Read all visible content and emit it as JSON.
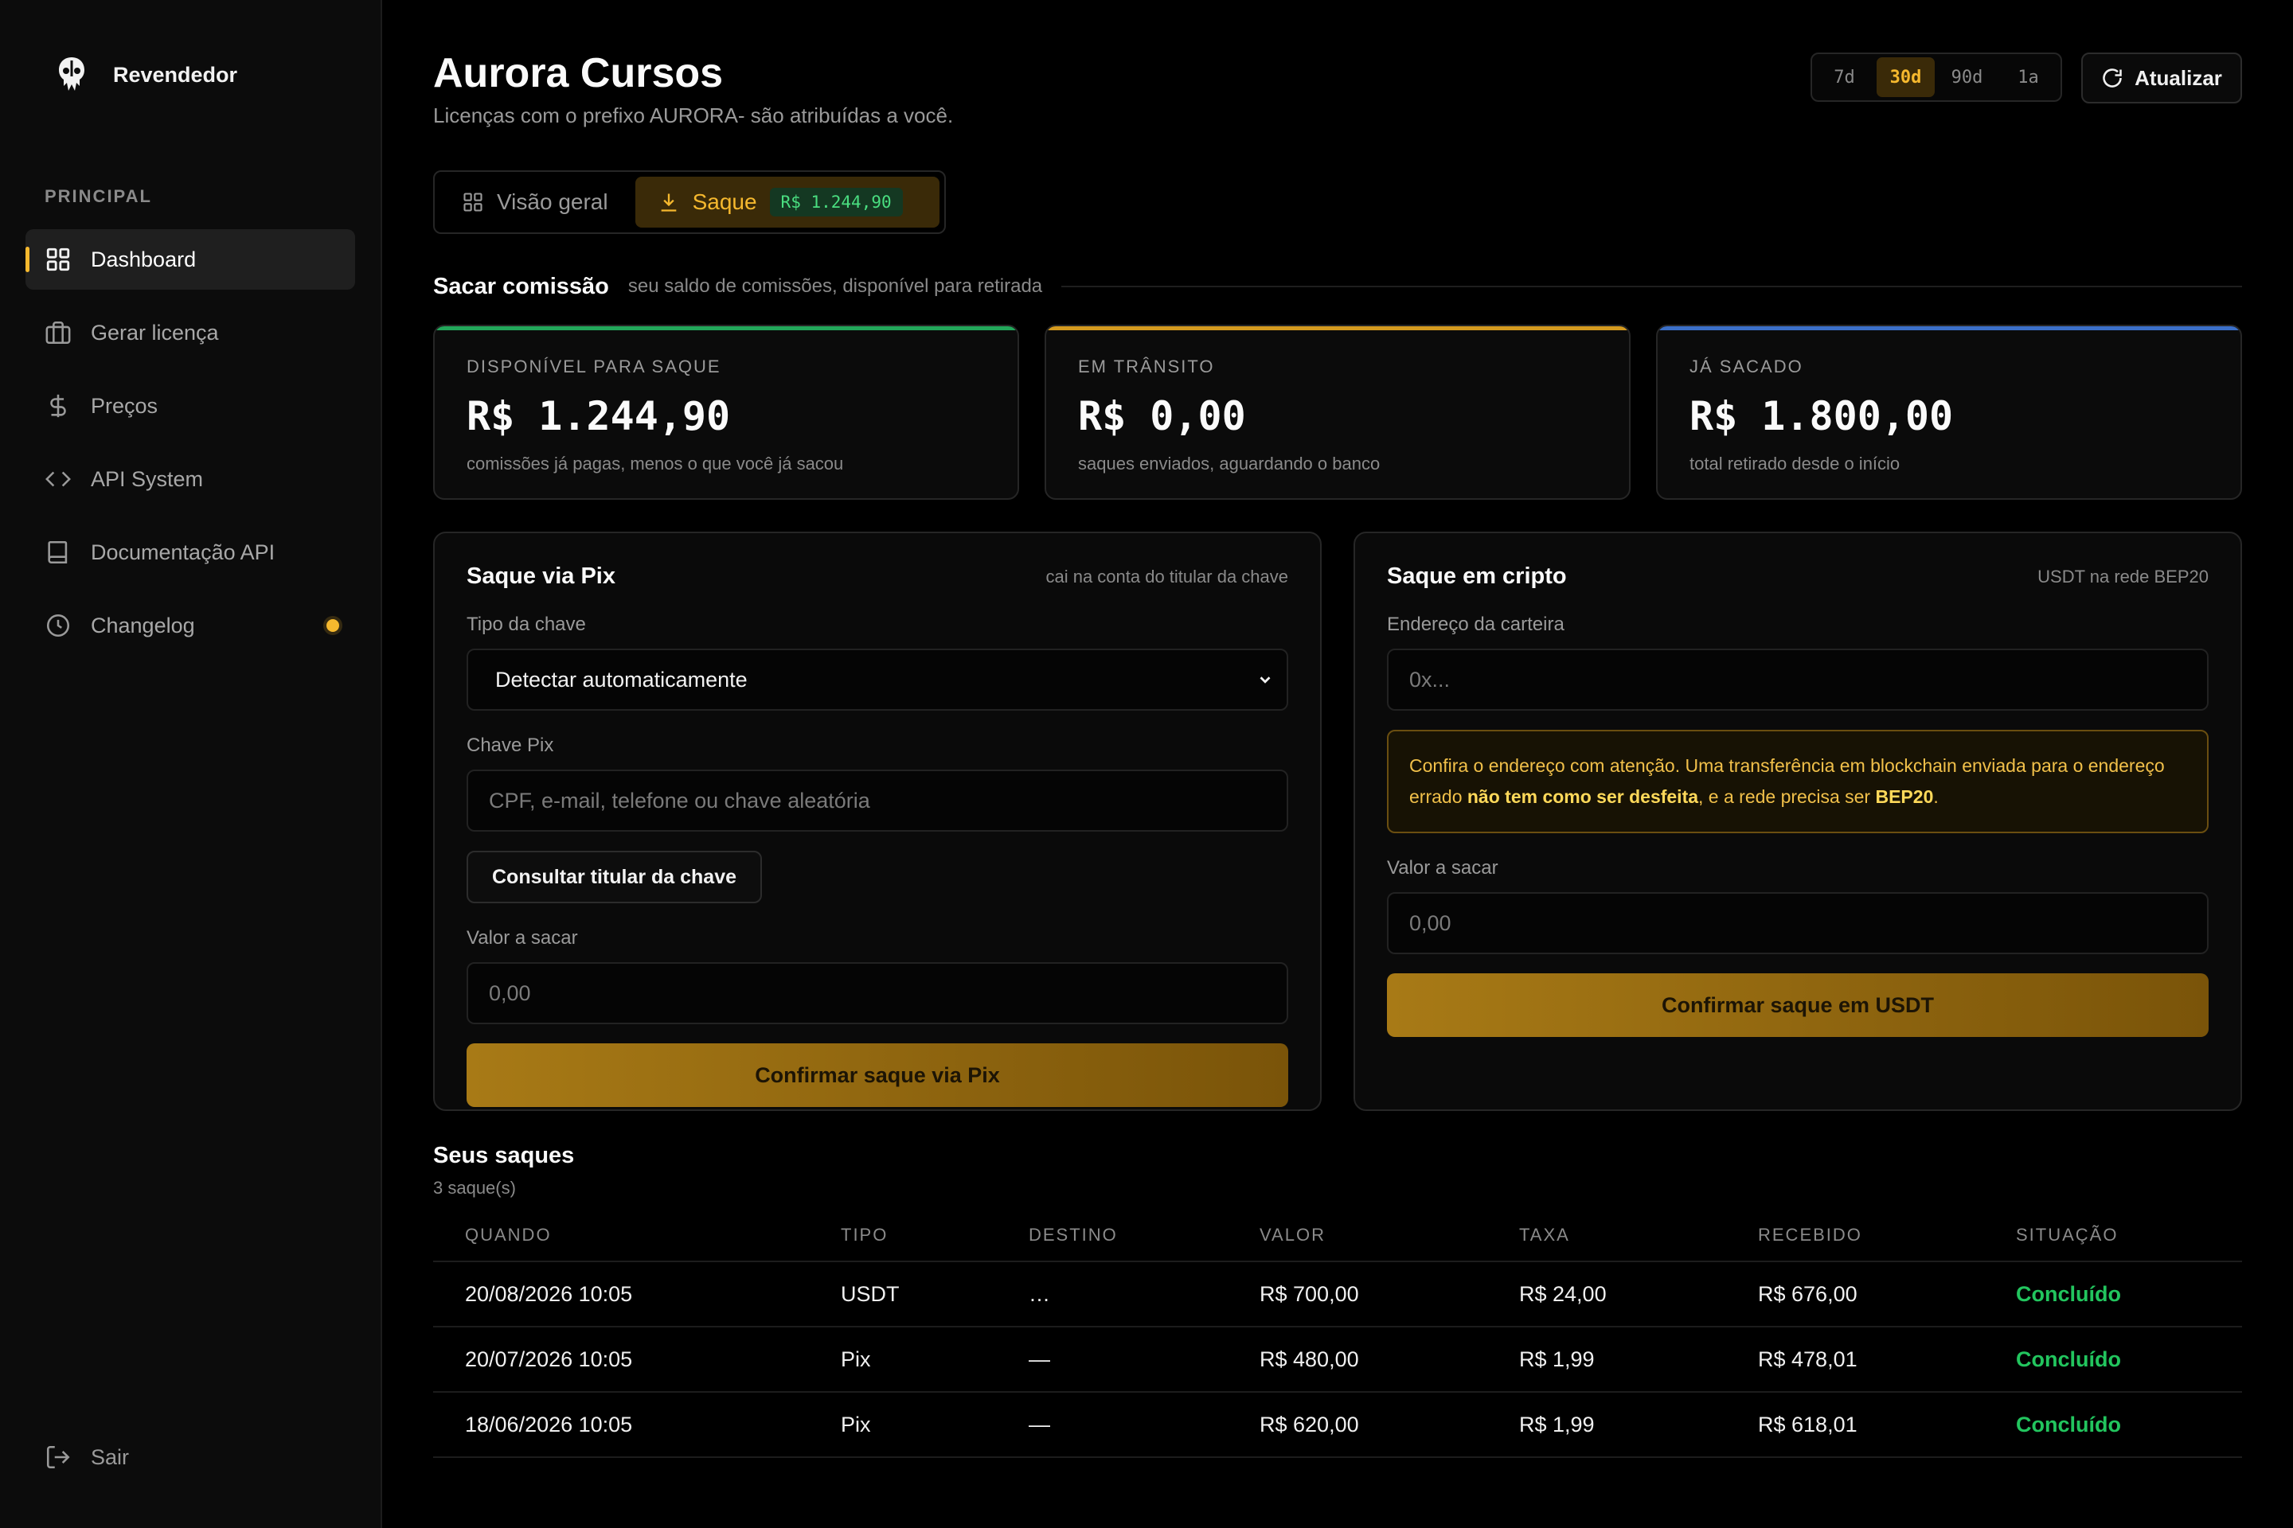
{
  "sidebar": {
    "brand": "Revendedor",
    "section": "PRINCIPAL",
    "items": [
      {
        "label": "Dashboard",
        "icon": "grid-icon"
      },
      {
        "label": "Gerar licença",
        "icon": "briefcase-icon"
      },
      {
        "label": "Preços",
        "icon": "dollar-icon"
      },
      {
        "label": "API System",
        "icon": "code-icon"
      },
      {
        "label": "Documentação API",
        "icon": "book-icon"
      },
      {
        "label": "Changelog",
        "icon": "clock-icon"
      }
    ],
    "logout": "Sair"
  },
  "header": {
    "title": "Aurora Cursos",
    "subtitle": "Licenças com o prefixo AURORA- são atribuídas a você.",
    "ranges": [
      "7d",
      "30d",
      "90d",
      "1a"
    ],
    "active_range": "30d",
    "refresh": "Atualizar"
  },
  "tabs": {
    "overview": "Visão geral",
    "withdraw": "Saque",
    "withdraw_badge": "R$ 1.244,90"
  },
  "section": {
    "title": "Sacar comissão",
    "desc": "seu saldo de comissões, disponível para retirada"
  },
  "stats": [
    {
      "label": "DISPONÍVEL PARA SAQUE",
      "value": "R$ 1.244,90",
      "note": "comissões já pagas, menos o que você já sacou",
      "color": "#22a75a"
    },
    {
      "label": "EM TRÂNSITO",
      "value": "R$ 0,00",
      "note": "saques enviados, aguardando o banco",
      "color": "#d49a1f"
    },
    {
      "label": "JÁ SACADO",
      "value": "R$ 1.800,00",
      "note": "total retirado desde o início",
      "color": "#3b6fc8"
    }
  ],
  "pix": {
    "title": "Saque via Pix",
    "hint": "cai na conta do titular da chave",
    "key_type_label": "Tipo da chave",
    "key_type_value": "Detectar automaticamente",
    "key_label": "Chave Pix",
    "key_placeholder": "CPF, e-mail, telefone ou chave aleatória",
    "lookup_button": "Consultar titular da chave",
    "amount_label": "Valor a sacar",
    "amount_placeholder": "0,00",
    "confirm": "Confirmar saque via Pix"
  },
  "crypto": {
    "title": "Saque em cripto",
    "hint": "USDT na rede BEP20",
    "wallet_label": "Endereço da carteira",
    "wallet_placeholder": "0x...",
    "warn_1": "Confira o endereço com atenção. Uma transferência em blockchain enviada para o endereço errado ",
    "warn_bold_1": "não tem como ser desfeita",
    "warn_2": ", e a rede precisa ser ",
    "warn_bold_2": "BEP20",
    "warn_3": ".",
    "amount_label": "Valor a sacar",
    "amount_placeholder": "0,00",
    "confirm": "Confirmar saque em USDT"
  },
  "withdrawals": {
    "title": "Seus saques",
    "count": "3 saque(s)",
    "columns": [
      "QUANDO",
      "TIPO",
      "DESTINO",
      "VALOR",
      "TAXA",
      "RECEBIDO",
      "SITUAÇÃO"
    ],
    "rows": [
      {
        "when": "20/08/2026 10:05",
        "type": "USDT",
        "dest": "…",
        "value": "R$ 700,00",
        "fee": "R$ 24,00",
        "received": "R$ 676,00",
        "status": "Concluído"
      },
      {
        "when": "20/07/2026 10:05",
        "type": "Pix",
        "dest": "—",
        "value": "R$ 480,00",
        "fee": "R$ 1,99",
        "received": "R$ 478,01",
        "status": "Concluído"
      },
      {
        "when": "18/06/2026 10:05",
        "type": "Pix",
        "dest": "—",
        "value": "R$ 620,00",
        "fee": "R$ 1,99",
        "received": "R$ 618,01",
        "status": "Concluído"
      }
    ]
  },
  "colors": {
    "accent": "#f5b82e",
    "success": "#22c55e",
    "background": "#000000"
  }
}
